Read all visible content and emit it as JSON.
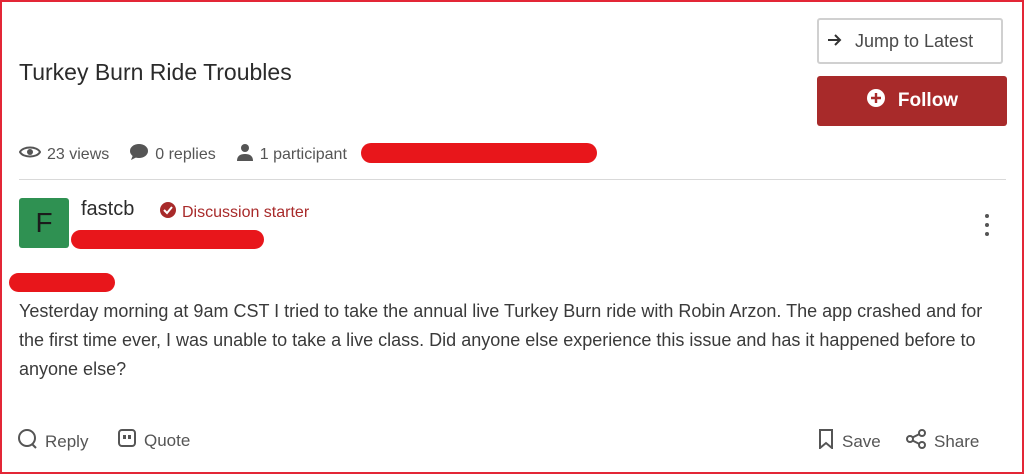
{
  "thread": {
    "title": "Turkey Burn Ride Troubles",
    "jump_label": "Jump to Latest",
    "follow_label": "Follow",
    "stats": {
      "views": "23 views",
      "replies": "0 replies",
      "participants": "1 participant"
    }
  },
  "post": {
    "avatar_letter": "F",
    "username": "fastcb",
    "badge": "Discussion starter",
    "body": "Yesterday morning at 9am CST I tried to take the annual live Turkey Burn ride with Robin Arzon. The app crashed and for the first time ever, I was unable to take a live class. Did anyone else experience this issue and has it happened before to anyone else?"
  },
  "actions": {
    "reply": "Reply",
    "quote": "Quote",
    "save": "Save",
    "share": "Share"
  },
  "colors": {
    "accent": "#a82a2a",
    "avatar_bg": "#2f9152",
    "redaction": "#e8161b",
    "frame": "#e32636"
  },
  "icons": [
    "arrow-right-icon",
    "plus-circle-icon",
    "eye-icon",
    "comment-icon",
    "user-icon",
    "check-badge-icon",
    "kebab-icon",
    "reply-icon",
    "quote-icon",
    "bookmark-icon",
    "share-icon"
  ]
}
